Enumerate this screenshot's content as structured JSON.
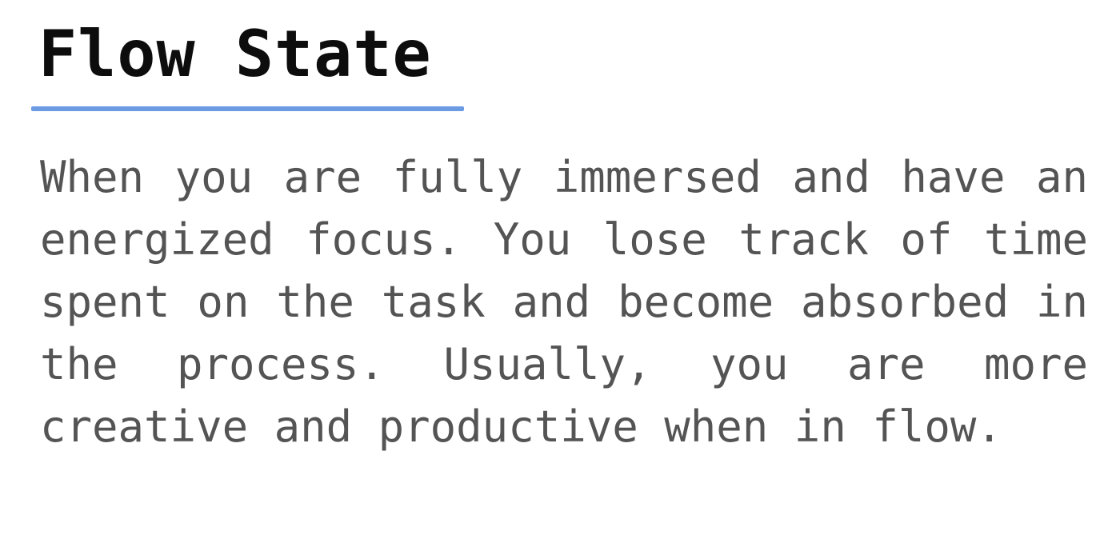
{
  "heading": {
    "title": "Flow State"
  },
  "content": {
    "paragraph": "When you are fully immersed and have an energized focus. You lose track of time spent on the task and become absorbed in the process. Usually, you are more creative and productive when in flow."
  },
  "colors": {
    "accent": "#6a9be3",
    "title": "#0d0d0d",
    "body_text": "#545454"
  }
}
